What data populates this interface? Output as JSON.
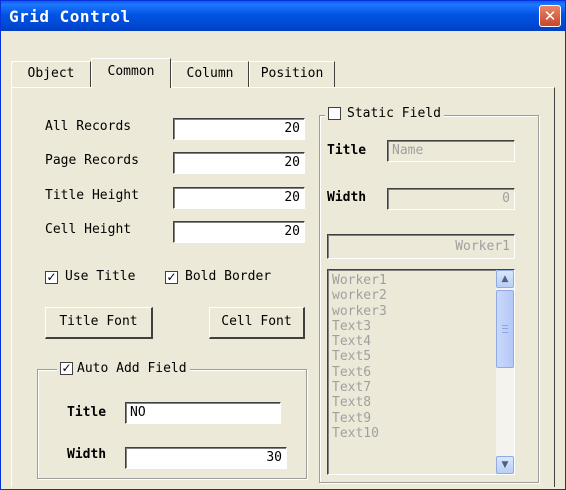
{
  "window": {
    "title": "Grid Control",
    "close_glyph": "✕"
  },
  "tabs": [
    {
      "label": "Object"
    },
    {
      "label": "Common",
      "active": true
    },
    {
      "label": "Column"
    },
    {
      "label": "Position"
    }
  ],
  "fields": {
    "all_records": {
      "label": "All Records",
      "value": "20"
    },
    "page_records": {
      "label": "Page Records",
      "value": "20"
    },
    "title_height": {
      "label": "Title Height",
      "value": "20"
    },
    "cell_height": {
      "label": "Cell Height",
      "value": "20"
    }
  },
  "options": {
    "use_title": {
      "label": "Use Title",
      "checked": true
    },
    "bold_border": {
      "label": "Bold Border",
      "checked": true
    }
  },
  "buttons": {
    "title_font": "Title Font",
    "cell_font": "Cell Font"
  },
  "auto_add_field": {
    "label": "Auto Add Field",
    "checked": true,
    "title_label": "Title",
    "title_value": "NO",
    "width_label": "Width",
    "width_value": "30"
  },
  "static_field": {
    "label": "Static Field",
    "checked": false,
    "title_label": "Title",
    "title_value": "Name",
    "width_label": "Width",
    "width_value": "0",
    "selected_value": "Worker1",
    "items": [
      "Worker1",
      "worker2",
      "worker3",
      "Text3",
      "Text4",
      "Text5",
      "Text6",
      "Text7",
      "Text8",
      "Text9",
      "Text10"
    ]
  },
  "icons": {
    "check": "✓",
    "scroll_up": "▲",
    "scroll_down": "▼"
  }
}
